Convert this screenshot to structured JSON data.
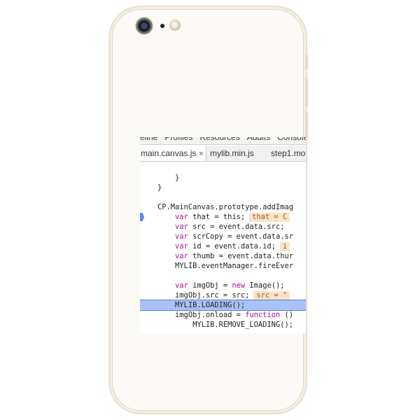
{
  "devtools": {
    "menu": [
      "eline",
      "Profiles",
      "Resources",
      "Audits",
      "Console"
    ],
    "tabs": [
      {
        "label": "main.canvas.js",
        "close": "×",
        "active": true
      },
      {
        "label": "mylib.min.js",
        "active": false
      },
      {
        "label": "step1.mo",
        "active": false
      }
    ],
    "code_lines": [
      {
        "parts": [
          {
            "t": "        }"
          }
        ]
      },
      {
        "parts": [
          {
            "t": "    }"
          }
        ]
      },
      {
        "parts": [
          {
            "t": ""
          }
        ]
      },
      {
        "parts": [
          {
            "t": "    CP.MainCanvas.prototype.addImag"
          }
        ]
      },
      {
        "parts": [
          {
            "t": "        ",
            "c": ""
          },
          {
            "t": "var",
            "c": "kw"
          },
          {
            "t": " that = this;"
          }
        ],
        "value": "that = C",
        "breakpoint": true
      },
      {
        "parts": [
          {
            "t": "        "
          },
          {
            "t": "var",
            "c": "kw"
          },
          {
            "t": " src = event.data.src;"
          }
        ]
      },
      {
        "parts": [
          {
            "t": "        "
          },
          {
            "t": "var",
            "c": "kw"
          },
          {
            "t": " scrCopy = event.data.sr"
          }
        ]
      },
      {
        "parts": [
          {
            "t": "        "
          },
          {
            "t": "var",
            "c": "kw"
          },
          {
            "t": " id = event.data.id;"
          }
        ],
        "value": "i"
      },
      {
        "parts": [
          {
            "t": "        "
          },
          {
            "t": "var",
            "c": "kw"
          },
          {
            "t": " thumb = event.data.thur"
          }
        ]
      },
      {
        "parts": [
          {
            "t": "        MYLIB.eventManager.fireEver"
          }
        ]
      },
      {
        "parts": [
          {
            "t": ""
          }
        ]
      },
      {
        "parts": [
          {
            "t": "        "
          },
          {
            "t": "var",
            "c": "kw"
          },
          {
            "t": " imgObj = "
          },
          {
            "t": "new",
            "c": "kw"
          },
          {
            "t": " Image();"
          }
        ]
      },
      {
        "parts": [
          {
            "t": "        imgObj.src = src;"
          }
        ],
        "value": "src = \""
      },
      {
        "parts": [
          {
            "t": "        MYLIB.LOADING();"
          }
        ],
        "highlight": true
      },
      {
        "parts": [
          {
            "t": "        imgObj.onload = "
          },
          {
            "t": "function",
            "c": "kw"
          },
          {
            "t": " ()"
          }
        ]
      },
      {
        "parts": [
          {
            "t": "            MYLIB.REMOVE_LOADING();"
          }
        ]
      }
    ]
  }
}
